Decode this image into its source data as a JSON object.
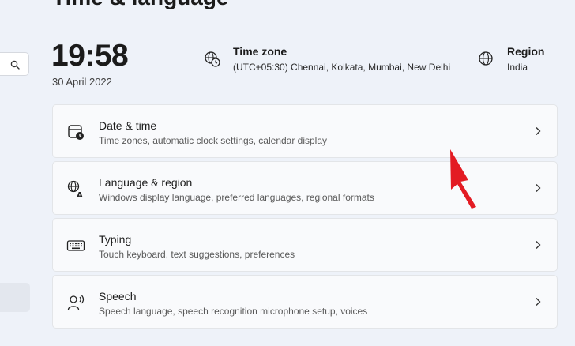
{
  "page": {
    "title": "Time & language"
  },
  "clock": {
    "time": "19:58",
    "date": "30 April 2022"
  },
  "timezone": {
    "label": "Time zone",
    "value": "(UTC+05:30) Chennai, Kolkata, Mumbai, New Delhi",
    "icon": "globe-clock-icon"
  },
  "region": {
    "label": "Region",
    "value": "India",
    "icon": "globe-icon"
  },
  "cards": [
    {
      "title": "Date & time",
      "subtitle": "Time zones, automatic clock settings, calendar display",
      "icon": "calendar-clock-icon"
    },
    {
      "title": "Language & region",
      "subtitle": "Windows display language, preferred languages, regional formats",
      "icon": "language-icon"
    },
    {
      "title": "Typing",
      "subtitle": "Touch keyboard, text suggestions, preferences",
      "icon": "keyboard-icon"
    },
    {
      "title": "Speech",
      "subtitle": "Speech language, speech recognition microphone setup, voices",
      "icon": "speech-icon"
    }
  ],
  "colors": {
    "background": "#eef2f9",
    "card": "#f9fafc",
    "annotation_arrow": "#e31b23"
  }
}
